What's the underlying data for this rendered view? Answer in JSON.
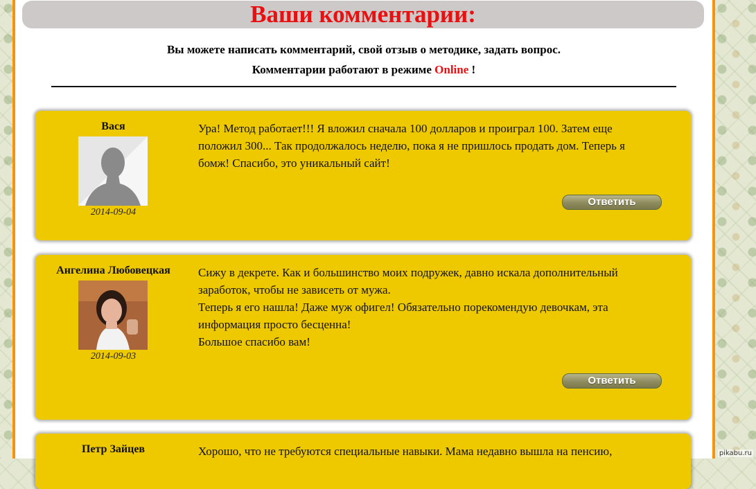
{
  "header": {
    "title": "Ваши комментарии:"
  },
  "intro": {
    "line1": "Вы можете написать комментарий, свой отзыв о методике, задать вопрос.",
    "line2_prefix": "Комментарии работают в режиме ",
    "line2_online": "Online",
    "line2_suffix": " !"
  },
  "comments": [
    {
      "author": "Вася",
      "date": "2014-09-04",
      "avatar": "default-silhouette",
      "lines": [
        "Ура! Метод работает!!! Я вложил сначала 100 долларов и проиграл 100. Затем еще",
        "положил 300... Так продолжалось неделю, пока я не пришлось продать дом. Теперь я",
        "бомж! Спасибо, это уникальный сайт!"
      ],
      "reply_label": "Ответить"
    },
    {
      "author": "Ангелина Любовецкая",
      "date": "2014-09-03",
      "avatar": "woman-photo",
      "lines": [
        "Сижу в декрете. Как и большинство моих подружек, давно искала дополнительный",
        "заработок, чтобы не зависеть от мужа.",
        "Теперь я его нашла! Даже муж офигел! Обязательно порекомендую девочкам, эта",
        "информация просто бесценна!",
        "Большое спасибо вам!"
      ],
      "reply_label": "Ответить"
    },
    {
      "author": "Петр Зайцев",
      "lines": [
        "Хорошо, что не требуются специальные навыки. Мама недавно вышла на пенсию,"
      ]
    }
  ],
  "watermark": "pikabu.ru",
  "colors": {
    "accent_red": "#e81010",
    "card_yellow": "#efc900",
    "border_orange": "#f7930a"
  }
}
